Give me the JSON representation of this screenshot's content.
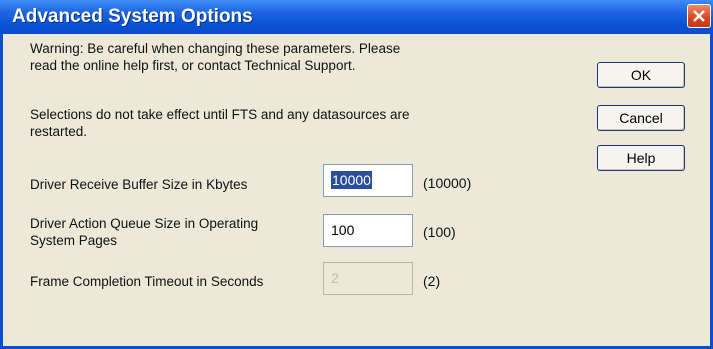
{
  "window": {
    "title": "Advanced System Options"
  },
  "messages": {
    "warning_line1": "Warning: Be careful when changing these parameters. Please",
    "warning_line2": "read the online help first, or contact Technical Support.",
    "restart_line1": "Selections do not take effect until FTS and any datasources are",
    "restart_line2": "restarted."
  },
  "buttons": {
    "ok": "OK",
    "cancel": "Cancel",
    "help": "Help"
  },
  "fields": [
    {
      "label_line1": "Driver Receive Buffer Size in Kbytes",
      "label_line2": "",
      "value": "10000",
      "default": "(10000)",
      "enabled": true,
      "selected": true
    },
    {
      "label_line1": "Driver Action Queue Size in Operating",
      "label_line2": "System Pages",
      "value": "100",
      "default": "(100)",
      "enabled": true,
      "selected": false
    },
    {
      "label_line1": "Frame Completion Timeout in Seconds",
      "label_line2": "",
      "value": "2",
      "default": "(2)",
      "enabled": false,
      "selected": false
    }
  ]
}
